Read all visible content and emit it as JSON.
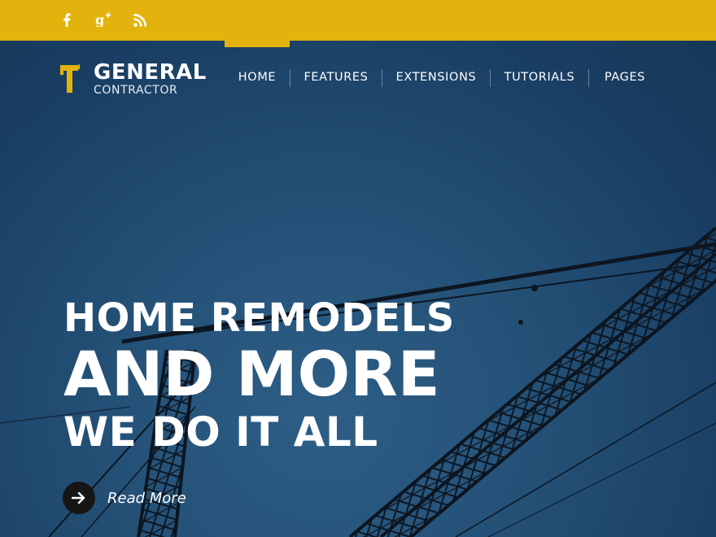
{
  "social": {
    "facebook_icon": "facebook-icon",
    "google_plus_icon": "google-plus-icon",
    "rss_icon": "rss-icon"
  },
  "brand": {
    "name": "GENERAL",
    "tagline": "CONTRACTOR",
    "icon": "hammer-icon"
  },
  "nav": {
    "items": [
      {
        "label": "HOME",
        "active": true
      },
      {
        "label": "FEATURES"
      },
      {
        "label": "EXTENSIONS"
      },
      {
        "label": "TUTORIALS"
      },
      {
        "label": "PAGES"
      }
    ]
  },
  "hero": {
    "line1": "HOME REMODELS",
    "line2": "AND MORE",
    "line3": "WE DO IT ALL",
    "read_more": "Read More",
    "read_more_icon": "arrow-right-icon"
  },
  "colors": {
    "accent": "#e3b30d",
    "hero_bg": "#1f4770",
    "button_dark": "#151515"
  }
}
